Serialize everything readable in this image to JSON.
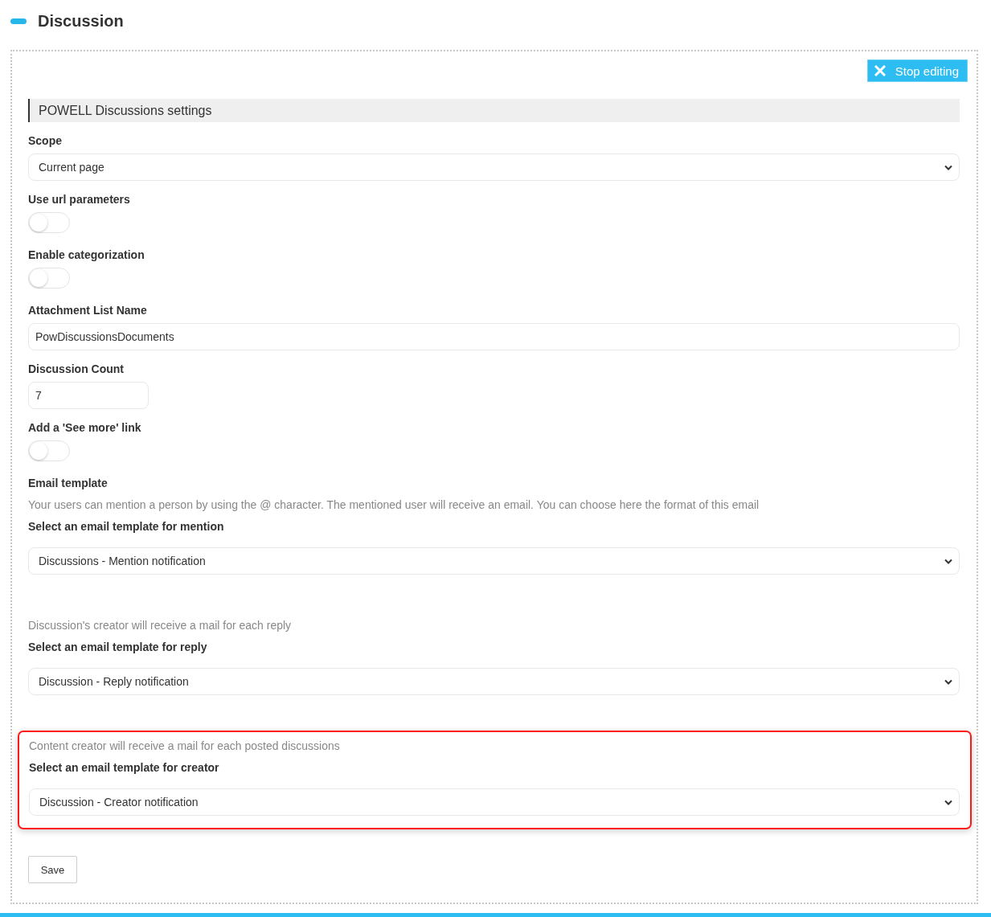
{
  "page_title": "Discussion",
  "stop_button": "Stop editing",
  "settings_title": "POWELL Discussions settings",
  "sections": [
    {
      "kind": "settings",
      "highlighted": false,
      "items": [
        {
          "kind": "label",
          "text": "Scope"
        },
        {
          "kind": "select",
          "value": "Current page"
        },
        {
          "kind": "label",
          "text": "Use url parameters"
        },
        {
          "kind": "toggle",
          "on": false
        },
        {
          "kind": "label",
          "text": "Enable categorization"
        },
        {
          "kind": "toggle",
          "on": false
        },
        {
          "kind": "label",
          "text": "Attachment List Name"
        },
        {
          "kind": "input",
          "value": "PowDiscussionsDocuments"
        },
        {
          "kind": "label",
          "text": "Discussion Count"
        },
        {
          "kind": "number",
          "value": "7"
        },
        {
          "kind": "label",
          "text": "Add a 'See more' link"
        },
        {
          "kind": "toggle",
          "on": false
        },
        {
          "kind": "label",
          "text": "Email template"
        },
        {
          "kind": "note",
          "text": "Your users can mention a person by using the @ character. The mentioned user will receive an email. You can choose here the format of this email"
        },
        {
          "kind": "label",
          "text": "Select an email template for mention"
        },
        {
          "kind": "select",
          "value": "Discussions - Mention notification"
        }
      ]
    },
    {
      "kind": "template",
      "highlighted": false,
      "items": [
        {
          "kind": "note",
          "text": "Discussion's creator will receive a mail for each reply"
        },
        {
          "kind": "label",
          "text": "Select an email template for reply"
        },
        {
          "kind": "select",
          "value": "Discussion - Reply notification"
        }
      ]
    },
    {
      "kind": "template",
      "highlighted": true,
      "items": [
        {
          "kind": "note",
          "text": "Content creator will receive a mail for each posted discussions"
        },
        {
          "kind": "label",
          "text": "Select an email template for creator"
        },
        {
          "kind": "select",
          "value": "Discussion - Creator notification"
        }
      ]
    }
  ],
  "save_button": "Save"
}
